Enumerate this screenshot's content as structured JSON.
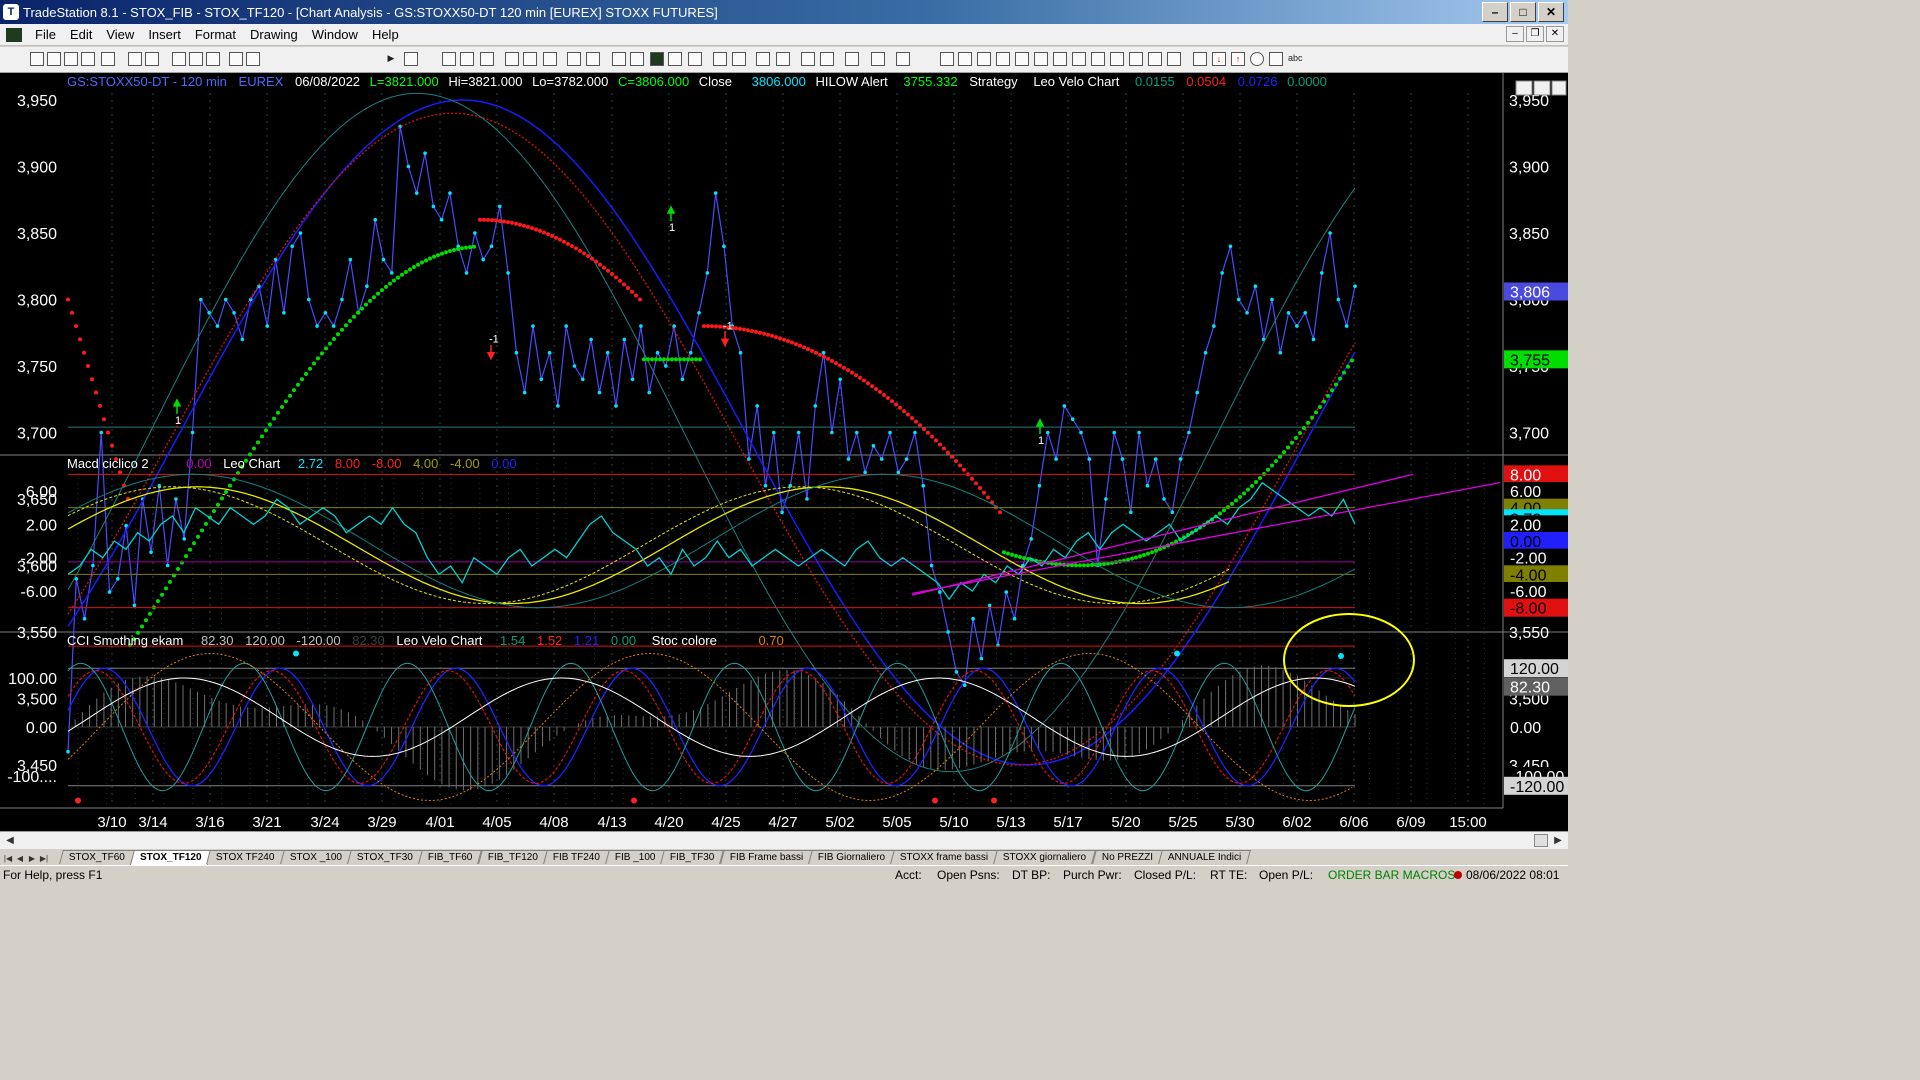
{
  "window": {
    "title": "TradeStation 8.1 - STOX_FIB - STOX_TF120 - [Chart Analysis - GS:STOXX50-DT  120 min  [EUREX] STOXX FUTURES]",
    "min": "–",
    "max": "□",
    "close": "✕"
  },
  "menu": [
    "File",
    "Edit",
    "View",
    "Insert",
    "Format",
    "Drawing",
    "Window",
    "Help"
  ],
  "toolbar": {
    "symbol_value": "741"
  },
  "chart": {
    "header": {
      "symbol": "GS:STOXX50-DT - 120 min",
      "exchange": "EUREX",
      "date": "06/08/2022",
      "last": "L=3821.000",
      "hi": "Hi=3821.000",
      "lo": "Lo=3782.000",
      "close_val": "C=3806.000",
      "close_label": "Close",
      "close_num": "3806.000",
      "hilow_label": "HILOW Alert",
      "hilow_val": "3755.332",
      "strategy": "Strategy",
      "leo_label": "Leo Velo Chart",
      "v1": "0.0155",
      "v2": "0.0504",
      "v3": "0.0726",
      "v4": "0.0000"
    },
    "price_axis": [
      "3,950",
      "3,900",
      "3,850",
      "3,800",
      "3,750",
      "3,700",
      "3,650",
      "3,600",
      "3,550",
      "3,500",
      "3,450"
    ],
    "price_tags": {
      "last": "3,806",
      "hilow": "3,755"
    },
    "arrow_labels": [
      "1",
      "-1",
      "1",
      "-1",
      "1"
    ],
    "macd": {
      "title": "Macd ciclico 2",
      "v0": "0.00",
      "leo": "Leo Chart",
      "a": "2.72",
      "b": "8.00",
      "c": "-8.00",
      "d": "4.00",
      "e": "-4.00",
      "f": "0.00",
      "axis": [
        "6.00",
        "2.00",
        "-2.00",
        "-6.00"
      ],
      "tags": [
        "8.00",
        "6.00",
        "4.00",
        "2.72",
        "2.00",
        "0.00",
        "-2.00",
        "-4.00",
        "-6.00",
        "-8.00"
      ]
    },
    "cci": {
      "title": "CCI Smothing ekam",
      "a": "82.30",
      "b": "120.00",
      "c": "-120.00",
      "d": "82.30",
      "leo": "Leo Velo Chart",
      "e": "1.54",
      "f": "1.52",
      "g": "1.21",
      "h": "0.00",
      "stoc": "Stoc colore",
      "i": "0.70",
      "axis": [
        "100.00",
        "0.00",
        "-100...."
      ],
      "tags": [
        "120.00",
        "82.30",
        "0.00",
        "-100.00",
        "-120.00"
      ]
    },
    "dates": [
      "3/10",
      "3/14",
      "3/16",
      "3/21",
      "3/24",
      "3/29",
      "4/01",
      "4/05",
      "4/08",
      "4/13",
      "4/20",
      "4/25",
      "4/27",
      "5/02",
      "5/05",
      "5/10",
      "5/13",
      "5/17",
      "5/20",
      "5/25",
      "5/30",
      "6/02",
      "6/06",
      "6/09",
      "15:00"
    ]
  },
  "tabs": [
    "STOX_TF60",
    "STOX_TF120",
    "STOX TF240",
    "STOX _100",
    "STOX_TF30",
    "FIB_TF60",
    "FIB_TF120",
    "FIB TF240",
    "FIB _100",
    "FIB_TF30",
    "FIB Frame bassi",
    "FIB Giornaliero",
    "STOXX frame bassi",
    "STOXX giornaliero",
    "No PREZZI",
    "ANNUALE Indici"
  ],
  "status": {
    "help": "For Help, press F1",
    "acct": "Acct:",
    "open_psns": "Open Psns:",
    "dt_bp": "DT BP:",
    "purch_pwr": "Purch Pwr:",
    "closed_pl": "Closed P/L:",
    "rt_te": "RT TE:",
    "open_pl": "Open P/L:",
    "macros": "ORDER BAR  MACROS",
    "datetime": "08/06/2022 08:01"
  },
  "colors": {
    "background": "#000000",
    "price_line": "#00e5ff",
    "ma_blue": "#1a1aff",
    "ma_red": "#e01010",
    "hilow_green": "#00dd00",
    "hilow_red": "#ff1a1a",
    "osc_yellow": "#e8e800",
    "trend_magenta": "#e000e0",
    "grid": "#1e4a4a",
    "highlight_circle": "#ffff00"
  }
}
